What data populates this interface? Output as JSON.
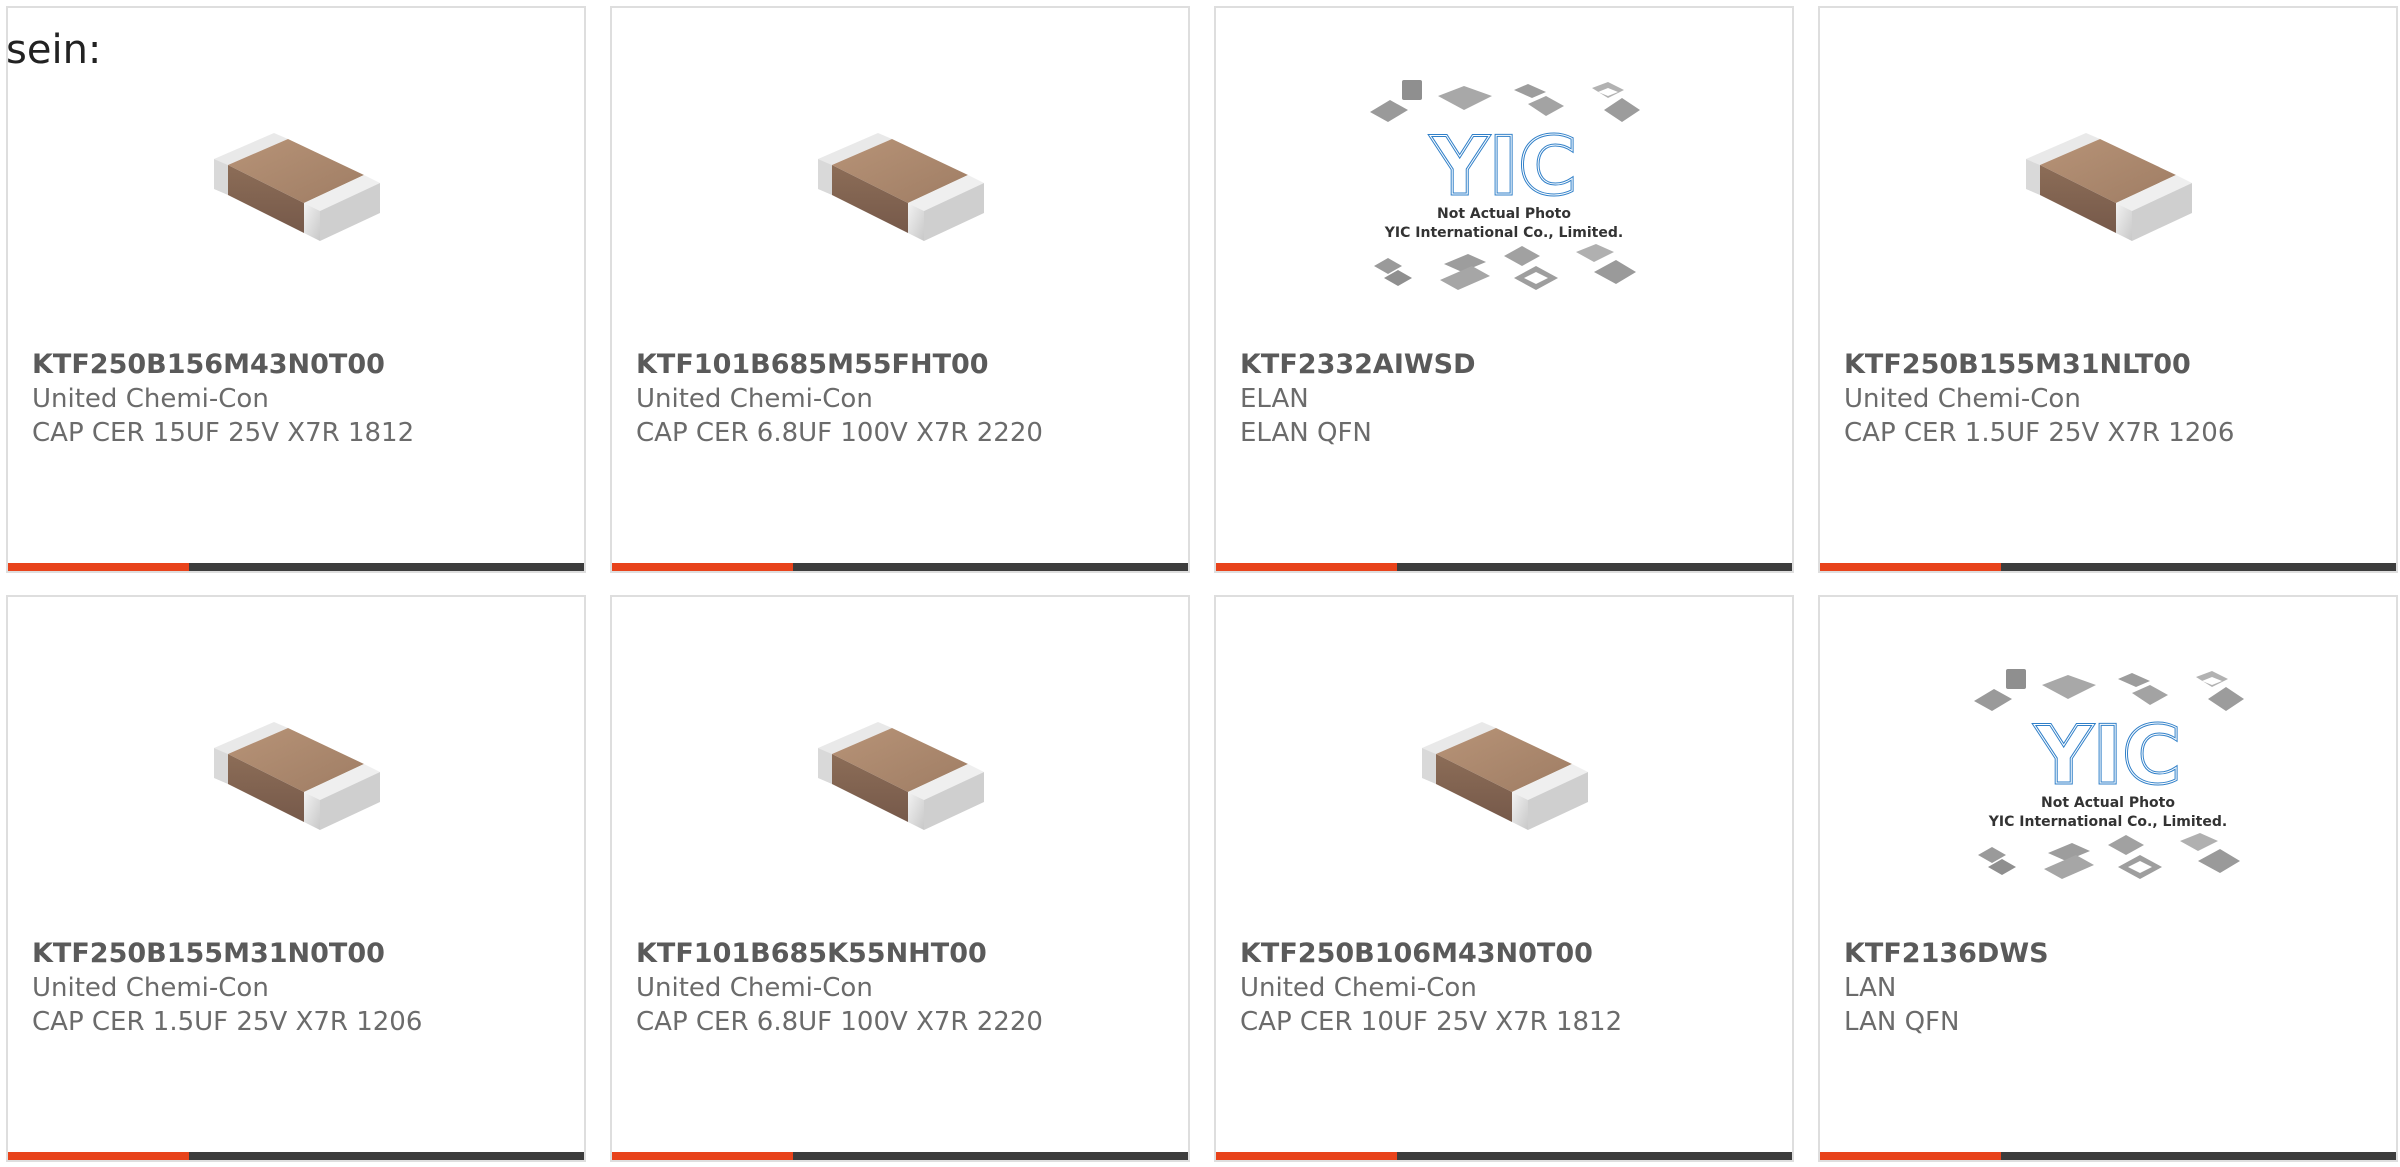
{
  "heading": "sein:",
  "colors": {
    "accent": "#e8431b",
    "bar_dark": "#3c3c3c",
    "card_border": "#dedede",
    "text": "#5a5a5a"
  },
  "placeholder_photo": {
    "line1": "Not Actual Photo",
    "line2": "YIC International Co., Limited."
  },
  "products": [
    {
      "part_number": "KTF250B156M43N0T00",
      "manufacturer": "United Chemi-Con",
      "description": "CAP CER 15UF 25V X7R 1812",
      "image": "capacitor-chip-icon"
    },
    {
      "part_number": "KTF101B685M55FHT00",
      "manufacturer": "United Chemi-Con",
      "description": "CAP CER 6.8UF 100V X7R 2220",
      "image": "capacitor-chip-icon"
    },
    {
      "part_number": "KTF2332AIWSD",
      "manufacturer": "ELAN",
      "description": "ELAN QFN",
      "image": "yic-placeholder-logo"
    },
    {
      "part_number": "KTF250B155M31NLT00",
      "manufacturer": "United Chemi-Con",
      "description": "CAP CER 1.5UF 25V X7R 1206",
      "image": "capacitor-chip-icon"
    },
    {
      "part_number": "KTF250B155M31N0T00",
      "manufacturer": "United Chemi-Con",
      "description": "CAP CER 1.5UF 25V X7R 1206",
      "image": "capacitor-chip-icon"
    },
    {
      "part_number": "KTF101B685K55NHT00",
      "manufacturer": "United Chemi-Con",
      "description": "CAP CER 6.8UF 100V X7R 2220",
      "image": "capacitor-chip-icon"
    },
    {
      "part_number": "KTF250B106M43N0T00",
      "manufacturer": "United Chemi-Con",
      "description": "CAP CER 10UF 25V X7R 1812",
      "image": "capacitor-chip-icon"
    },
    {
      "part_number": "KTF2136DWS",
      "manufacturer": "LAN",
      "description": "LAN QFN",
      "image": "yic-placeholder-logo"
    }
  ]
}
